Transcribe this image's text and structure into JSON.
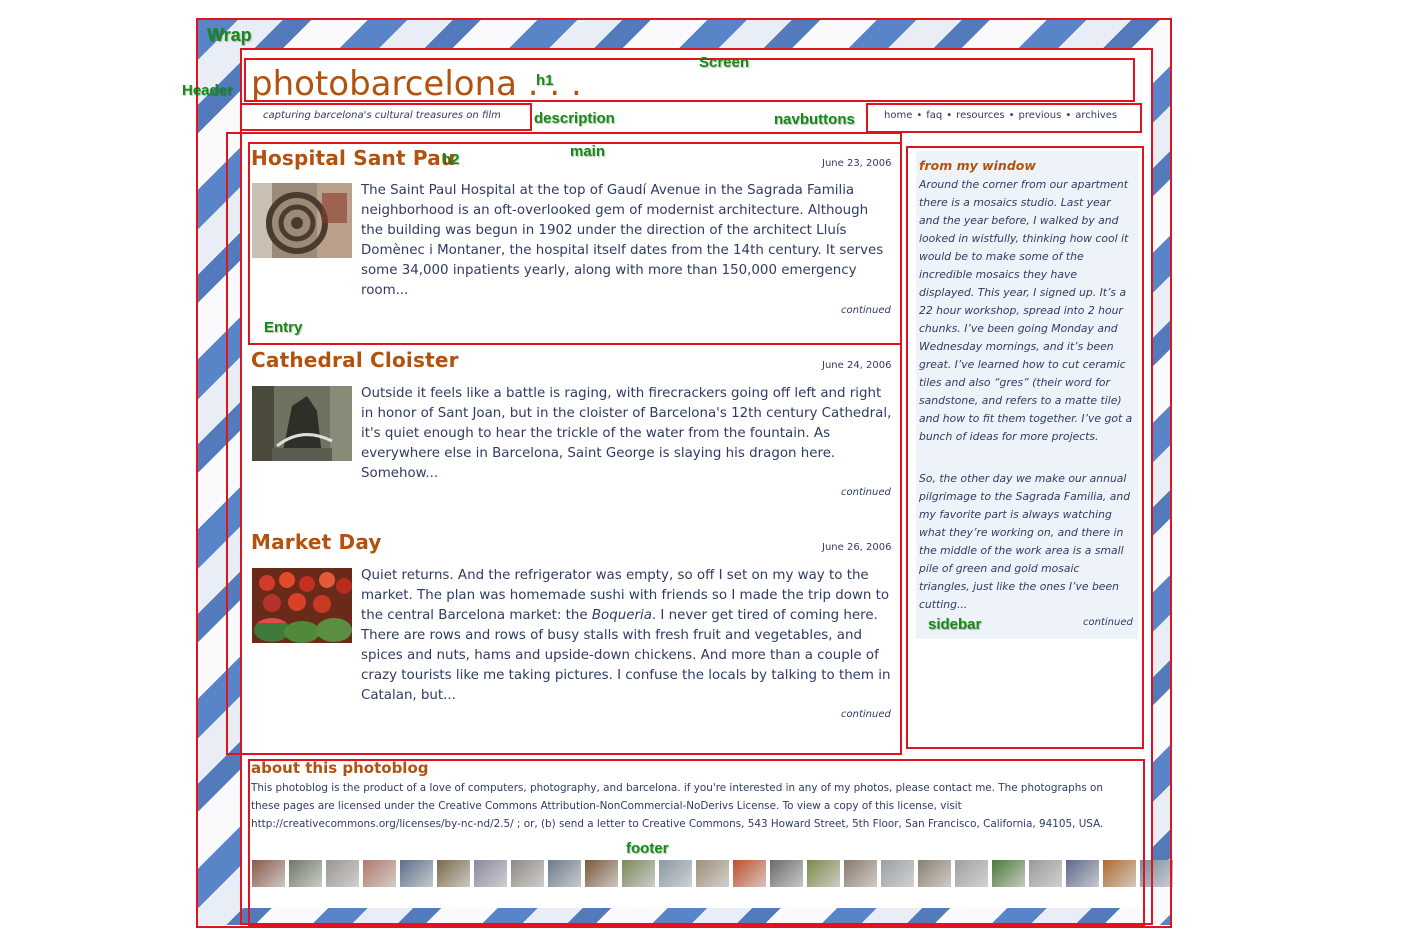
{
  "header": {
    "title": "photobarcelona . . .",
    "description": "capturing barcelona's cultural treasures on film",
    "nav": [
      "home",
      "faq",
      "resources",
      "previous",
      "archives"
    ],
    "nav_separator": "•"
  },
  "entries": [
    {
      "title": "Hospital Sant Pau",
      "date": "June 23, 2006",
      "text": "The Saint Paul Hospital at the top of Gaudí Avenue in the Sagrada Familia neighborhood is an oft-overlooked gem of modernist architecture. Although the building was begun in 1902 under the direction of the architect Lluís Domènec i Montaner, the hospital itself dates from the 14th century. It serves some 34,000 inpatients yearly, along with more than 150,000 emergency room...",
      "continued": "continued"
    },
    {
      "title": "Cathedral Cloister",
      "date": "June 24, 2006",
      "text": "Outside it feels like a battle is raging, with firecrackers going off left and right in honor of Sant Joan, but in the cloister of Barcelona's 12th century Cathedral, it's quiet enough to hear the trickle of the water from the fountain. As everywhere else in Barcelona, Saint George is slaying his dragon here. Somehow...",
      "continued": "continued"
    },
    {
      "title": "Market Day",
      "date": "June 26, 2006",
      "text_before": "Quiet returns. And the refrigerator was empty, so off I set on my way to the market. The plan was homemade sushi with friends so I made the trip down to the central Barcelona market: the ",
      "text_em": "Boqueria",
      "text_after": ". I never get tired of coming here. There are rows and rows of busy stalls with fresh fruit and vegetables, and spices and nuts, hams and upside-down chickens. And more than a couple of crazy tourists like me taking pictures. I confuse the locals by talking to them in Catalan, but...",
      "continued": "continued"
    }
  ],
  "sidebar": {
    "title": "from my window",
    "paragraphs": [
      "Around the corner from our apartment there is a mosaics studio. Last year and the year before, I walked by and looked in wistfully, thinking how cool it would be to make some of the incredible mosaics they have displayed. This year, I signed up. It’s a 22 hour workshop, spread into 2 hour chunks. I’ve been going Monday and Wednesday mornings, and it’s been great. I’ve learned how to cut ceramic tiles and also “gres” (their word for sandstone, and refers to a matte tile) and how to fit them together. I’ve got a bunch of ideas for more projects.",
      "So, the other day we make our annual pilgrimage to the Sagrada Familia, and my favorite part is always watching what they’re working on, and there in the middle of the work area is a small pile of green and gold mosaic triangles, just like the ones I’ve been cutting..."
    ],
    "continued": "continued"
  },
  "footer": {
    "title": "about this photoblog",
    "text": "This photoblog is the product of a love of computers, photography, and barcelona. if you're interested in any of my photos, please contact me. The photographs on these pages are licensed under the Creative Commons Attribution-NonCommercial-NoDerivs License. To view a copy of this license, visit  http://creativecommons.org/licenses/by-nc-nd/2.5/ ; or, (b) send a letter to Creative Commons, 543 Howard Street, 5th Floor, San Francisco, California, 94105, USA.",
    "thumbnail_colors": [
      "#8a5a4a",
      "#6f7a6a",
      "#9a9590",
      "#b07a6a",
      "#5a6f8a",
      "#7a6a4a",
      "#8a8aa0",
      "#8f8a84",
      "#6a7a8a",
      "#7a5a3a",
      "#7a8a5a",
      "#8a9aa5",
      "#a0907a",
      "#c0502a",
      "#6a6a6a",
      "#7a8a4a",
      "#8a7a6a",
      "#9aa0a5",
      "#8a8070",
      "#a0a0a0",
      "#4a7a3a",
      "#9a9a9a",
      "#5a6a8a",
      "#b06a2a",
      "#7a8aa0"
    ]
  },
  "annotations": {
    "wrap": "Wrap",
    "header": "Header",
    "screen": "Screen",
    "h1": "h1",
    "description": "description",
    "navbuttons": "navbuttons",
    "main": "main",
    "h2": "h2",
    "entry": "Entry",
    "sidebar": "sidebar",
    "footer": "footer"
  },
  "colors": {
    "accent": "#b2520e",
    "text": "#2f3b63",
    "annotation_box": "#e0141e",
    "annotation_label": "#168a16",
    "sidebar_bg": "#eef3f9"
  }
}
